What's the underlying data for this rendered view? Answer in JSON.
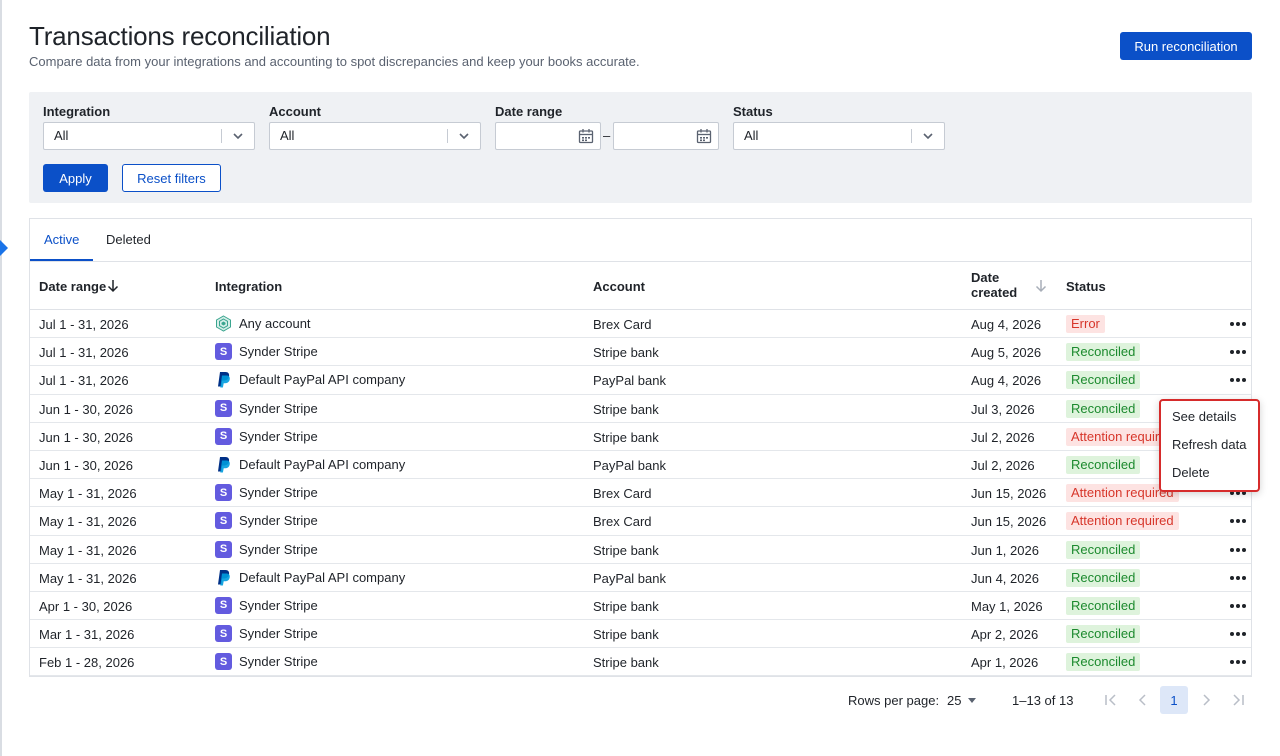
{
  "header": {
    "title": "Transactions reconciliation",
    "subtitle": "Compare data from your integrations and accounting to spot discrepancies and keep your books accurate.",
    "primary_action": "Run reconciliation"
  },
  "filters": {
    "integration": {
      "label": "Integration",
      "value": "All"
    },
    "account": {
      "label": "Account",
      "value": "All"
    },
    "date_range": {
      "label": "Date range",
      "separator": "–"
    },
    "status": {
      "label": "Status",
      "value": "All"
    },
    "apply": "Apply",
    "reset": "Reset filters"
  },
  "tabs": [
    {
      "label": "Active",
      "active": true
    },
    {
      "label": "Deleted",
      "active": false
    }
  ],
  "columns": {
    "date_range": "Date range",
    "integration": "Integration",
    "account": "Account",
    "date_created_1": "Date",
    "date_created_2": "created",
    "status": "Status"
  },
  "rows": [
    {
      "date": "Jul 1 - 31, 2026",
      "logo": "generic",
      "integration": "Any account",
      "account": "Brex Card",
      "created": "Aug 4, 2026",
      "status": "Error",
      "tone": "err"
    },
    {
      "date": "Jul 1 - 31, 2026",
      "logo": "stripe",
      "integration": "Synder Stripe",
      "account": "Stripe bank",
      "created": "Aug 5, 2026",
      "status": "Reconciled",
      "tone": "ok"
    },
    {
      "date": "Jul 1 - 31, 2026",
      "logo": "paypal",
      "integration": "Default PayPal API company",
      "account": "PayPal bank",
      "created": "Aug 4, 2026",
      "status": "Reconciled",
      "tone": "ok"
    },
    {
      "date": "Jun 1 - 30, 2026",
      "logo": "stripe",
      "integration": "Synder Stripe",
      "account": "Stripe bank",
      "created": "Jul 3, 2026",
      "status": "Reconciled",
      "tone": "ok"
    },
    {
      "date": "Jun 1 - 30, 2026",
      "logo": "stripe",
      "integration": "Synder Stripe",
      "account": "Stripe bank",
      "created": "Jul 2, 2026",
      "status": "Attention required",
      "tone": "err"
    },
    {
      "date": "Jun 1 - 30, 2026",
      "logo": "paypal",
      "integration": "Default PayPal API company",
      "account": "PayPal bank",
      "created": "Jul 2, 2026",
      "status": "Reconciled",
      "tone": "ok"
    },
    {
      "date": "May 1 - 31, 2026",
      "logo": "stripe",
      "integration": "Synder Stripe",
      "account": "Brex Card",
      "created": "Jun 15, 2026",
      "status": "Attention required",
      "tone": "err"
    },
    {
      "date": "May 1 - 31, 2026",
      "logo": "stripe",
      "integration": "Synder Stripe",
      "account": "Brex Card",
      "created": "Jun 15, 2026",
      "status": "Attention required",
      "tone": "err"
    },
    {
      "date": "May 1 - 31, 2026",
      "logo": "stripe",
      "integration": "Synder Stripe",
      "account": "Stripe bank",
      "created": "Jun 1, 2026",
      "status": "Reconciled",
      "tone": "ok"
    },
    {
      "date": "May 1 - 31, 2026",
      "logo": "paypal",
      "integration": "Default PayPal API company",
      "account": "PayPal bank",
      "created": "Jun 4, 2026",
      "status": "Reconciled",
      "tone": "ok"
    },
    {
      "date": "Apr 1 - 30, 2026",
      "logo": "stripe",
      "integration": "Synder Stripe",
      "account": "Stripe bank",
      "created": "May 1, 2026",
      "status": "Reconciled",
      "tone": "ok"
    },
    {
      "date": "Mar 1 - 31, 2026",
      "logo": "stripe",
      "integration": "Synder Stripe",
      "account": "Stripe bank",
      "created": "Apr 2, 2026",
      "status": "Reconciled",
      "tone": "ok"
    },
    {
      "date": "Feb 1 - 28, 2026",
      "logo": "stripe",
      "integration": "Synder Stripe",
      "account": "Stripe bank",
      "created": "Apr 1, 2026",
      "status": "Reconciled",
      "tone": "ok"
    }
  ],
  "row_menu": {
    "items": [
      "See details",
      "Refresh data",
      "Delete"
    ]
  },
  "pagination": {
    "rows_per_page_label": "Rows per page:",
    "rows_per_page": "25",
    "range": "1–13 of 13",
    "current_page": "1"
  },
  "colors": {
    "primary": "#0b50c8",
    "success_bg": "#def3dc",
    "success_text": "#1c8a2e",
    "error_bg": "#fde3e2",
    "error_text": "#d7362b",
    "stripe": "#635bdf",
    "paypal_dark": "#003087",
    "paypal_light": "#009cde",
    "menu_highlight": "#d62b2b"
  },
  "icons": {
    "sort_desc": "arrow-down-icon",
    "chevron": "chevron-down-icon",
    "calendar": "calendar-icon",
    "more": "more-horizontal-icon",
    "first": "first-page-icon",
    "prev": "prev-page-icon",
    "next": "next-page-icon",
    "last": "last-page-icon"
  }
}
